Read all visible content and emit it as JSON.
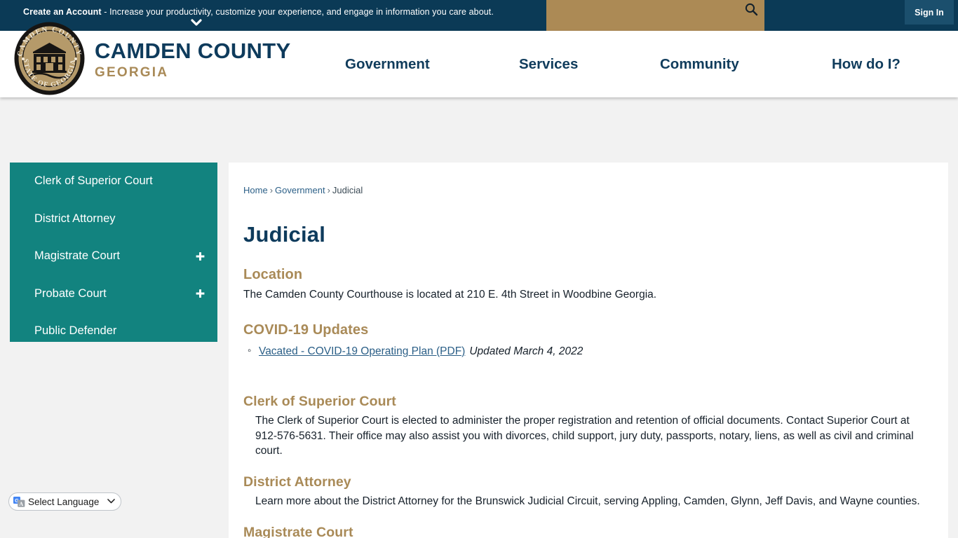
{
  "topbar": {
    "promo_bold": "Create an Account",
    "promo_rest": " - Increase your productivity, customize your experience, and engage in information you care about.",
    "signin_label": "Sign In",
    "search_placeholder": "",
    "search_value": "",
    "search_icon": "search-icon",
    "chevron_icon": "chevron-down-icon",
    "bg_color": "#0b3a56",
    "search_bg_color": "#ac8a55"
  },
  "header": {
    "brand_name": "CAMDEN COUNTY",
    "brand_sub": "GEORGIA",
    "seal_alt": "county-seal",
    "seal_top_text": "CAMDEN COUNTY",
    "seal_bottom_text": "STATE OF GEORGIA",
    "brand_color": "#0e3b5c",
    "accent_color": "#a98a57",
    "nav": [
      {
        "label": "Government"
      },
      {
        "label": "Services"
      },
      {
        "label": "Community"
      },
      {
        "label": "How do I?"
      }
    ]
  },
  "sidebar": {
    "bg_color": "#12837f",
    "items": [
      {
        "label": "Clerk of Superior Court",
        "expandable": false
      },
      {
        "label": "District Attorney",
        "expandable": false
      },
      {
        "label": "Magistrate Court",
        "expandable": true
      },
      {
        "label": "Probate Court",
        "expandable": true
      },
      {
        "label": "Public Defender",
        "expandable": false
      }
    ]
  },
  "translate": {
    "label": "Select Language",
    "icon": "google-translate-icon",
    "caret": "⌄"
  },
  "main": {
    "breadcrumb": {
      "home": "Home",
      "sep1": "›",
      "government": "Government",
      "sep2": "›",
      "current": "Judicial"
    },
    "title": "Judicial",
    "location": {
      "heading": "Location",
      "text": "The Camden County Courthouse is located at 210 E. 4th Street in Woodbine Georgia."
    },
    "covid": {
      "heading": "COVID-19 Updates",
      "link_text": "Vacated - COVID-19 Operating Plan (PDF)",
      "note": "Updated March 4, 2022"
    },
    "sections": [
      {
        "heading": "Clerk of Superior Court",
        "text": "The Clerk of Superior Court is elected to administer the proper registration and retention of official documents. Contact Superior Court at 912-576-5631. Their office may also assist you with divorces, child support, jury duty, passports, notary, liens, as well as civil and criminal court."
      },
      {
        "heading": "District Attorney",
        "text": "Learn more about the District Attorney for the Brunswick Judicial Circuit, serving Appling, Camden, Glynn, Jeff Davis, and Wayne counties."
      },
      {
        "heading": "Magistrate Court",
        "text": ""
      }
    ]
  }
}
